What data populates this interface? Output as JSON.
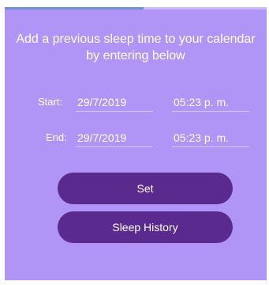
{
  "progress": {
    "fraction": 0.53
  },
  "instructions": "Add a previous sleep time to your calendar by entering below",
  "start": {
    "label": "Start:",
    "date": "29/7/2019",
    "time": "05:23 p. m."
  },
  "end": {
    "label": "End:",
    "date": "29/7/2019",
    "time": "05:23 p. m."
  },
  "buttons": {
    "set": "Set",
    "history": "Sleep History"
  },
  "colors": {
    "background": "#b195f6",
    "button": "#5b2a8e",
    "progress": "#6d8fd8"
  }
}
